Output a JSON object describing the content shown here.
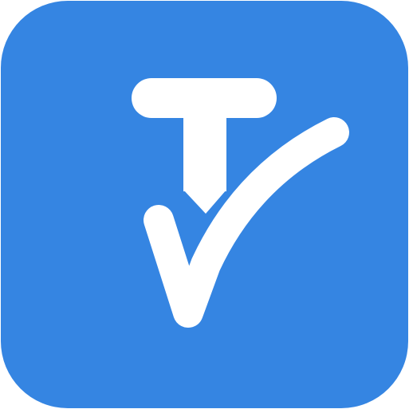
{
  "app_icon": {
    "name": "tv-checkmark-app-icon",
    "colors": {
      "background": "#3585E2",
      "glyph": "#FFFFFF"
    },
    "glyph_icons": [
      "letter-t-icon",
      "checkmark-icon"
    ]
  }
}
